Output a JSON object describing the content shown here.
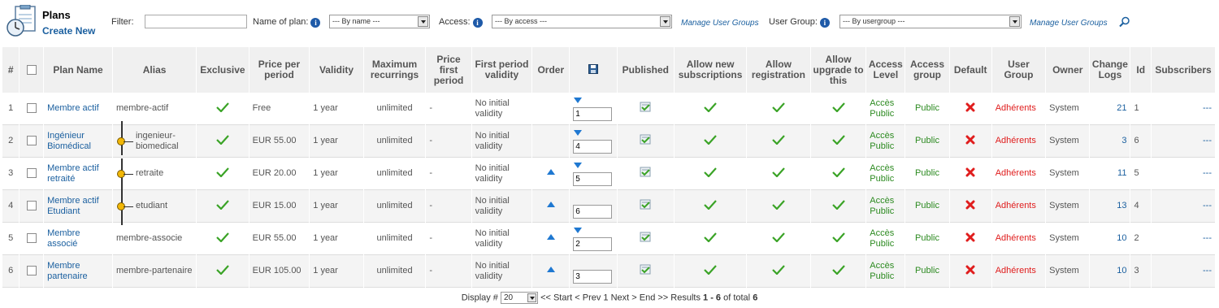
{
  "header": {
    "title": "Plans",
    "create_new": "Create New",
    "filter_label": "Filter:",
    "filter_value": "",
    "name_of_plan_label": "Name of plan:",
    "name_select": "--- By name ---",
    "access_label": "Access:",
    "access_select": "--- By access ---",
    "manage_user_groups": "Manage User Groups",
    "user_group_label": "User Group:",
    "usergroup_select": "--- By usergroup ---",
    "manage_user_groups_2": "Manage User Groups"
  },
  "columns": [
    "#",
    "",
    "Plan Name",
    "Alias",
    "Exclusive",
    "Price per period",
    "Validity",
    "Maximum recurrings",
    "Price first period",
    "First period validity",
    "Order",
    "",
    "Published",
    "Allow new subscriptions",
    "Allow registration",
    "Allow upgrade to this",
    "Access Level",
    "Access group",
    "Default",
    "User Group",
    "Owner",
    "Change Logs",
    "Id",
    "Subscribers"
  ],
  "rows": [
    {
      "num": "1",
      "name": "Membre actif",
      "alias": "membre-actif",
      "tree": false,
      "price": "Free",
      "validity": "1 year",
      "max_rec": "unlimited",
      "price_first": "-",
      "first_validity": "No initial validity",
      "up": false,
      "down": true,
      "order": "1",
      "access_level": "Accès Public",
      "access_group": "Public",
      "user_group": "Adhérents",
      "owner": "System",
      "change_logs": "21",
      "id": "1",
      "subscribers": "---"
    },
    {
      "num": "2",
      "name": "Ingénieur Biomédical",
      "alias": "ingenieur-biomedical",
      "tree": true,
      "price": "EUR 55.00",
      "validity": "1 year",
      "max_rec": "unlimited",
      "price_first": "-",
      "first_validity": "No initial validity",
      "up": false,
      "down": true,
      "order": "4",
      "access_level": "Accès Public",
      "access_group": "Public",
      "user_group": "Adhérents",
      "owner": "System",
      "change_logs": "3",
      "id": "6",
      "subscribers": "---"
    },
    {
      "num": "3",
      "name": "Membre actif retraité",
      "alias": "retraite",
      "tree": true,
      "price": "EUR 20.00",
      "validity": "1 year",
      "max_rec": "unlimited",
      "price_first": "-",
      "first_validity": "No initial validity",
      "up": true,
      "down": true,
      "order": "5",
      "access_level": "Accès Public",
      "access_group": "Public",
      "user_group": "Adhérents",
      "owner": "System",
      "change_logs": "11",
      "id": "5",
      "subscribers": "---"
    },
    {
      "num": "4",
      "name": "Membre actif Etudiant",
      "alias": "etudiant",
      "tree": true,
      "price": "EUR 15.00",
      "validity": "1 year",
      "max_rec": "unlimited",
      "price_first": "-",
      "first_validity": "No initial validity",
      "up": true,
      "down": false,
      "order": "6",
      "access_level": "Accès Public",
      "access_group": "Public",
      "user_group": "Adhérents",
      "owner": "System",
      "change_logs": "13",
      "id": "4",
      "subscribers": "---"
    },
    {
      "num": "5",
      "name": "Membre associé",
      "alias": "membre-associe",
      "tree": false,
      "price": "EUR 55.00",
      "validity": "1 year",
      "max_rec": "unlimited",
      "price_first": "-",
      "first_validity": "No initial validity",
      "up": true,
      "down": true,
      "order": "2",
      "access_level": "Accès Public",
      "access_group": "Public",
      "user_group": "Adhérents",
      "owner": "System",
      "change_logs": "10",
      "id": "2",
      "subscribers": "---"
    },
    {
      "num": "6",
      "name": "Membre partenaire",
      "alias": "membre-partenaire",
      "tree": false,
      "price": "EUR 105.00",
      "validity": "1 year",
      "max_rec": "unlimited",
      "price_first": "-",
      "first_validity": "No initial validity",
      "up": true,
      "down": false,
      "order": "3",
      "access_level": "Accès Public",
      "access_group": "Public",
      "user_group": "Adhérents",
      "owner": "System",
      "change_logs": "10",
      "id": "3",
      "subscribers": "---"
    }
  ],
  "pager": {
    "display_label": "Display #",
    "display_value": "20",
    "nav": "<< Start < Prev 1 Next > End >> Results",
    "range": "1 - 6",
    "of_total": "of total",
    "total": "6"
  },
  "colors": {
    "link": "#1a5f9f",
    "green": "#2c8a20",
    "red": "#e01d1d",
    "header_bg": "#f0f0f0"
  }
}
